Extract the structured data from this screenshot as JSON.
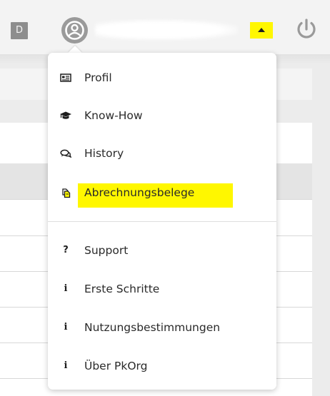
{
  "header": {
    "user_initial": "D",
    "dropdown_caret": "caret-up-icon",
    "power": "power-icon",
    "avatar": "user-circle-icon",
    "highlight_color": "#fff700"
  },
  "menu": {
    "items": [
      {
        "label": "Profil",
        "icon": "id-card-icon"
      },
      {
        "label": "Know-How",
        "icon": "graduation-cap-icon"
      },
      {
        "label": "History",
        "icon": "chat-bubbles-icon"
      },
      {
        "label": "Abrechnungsbelege",
        "icon": "copy-icon",
        "highlighted": true
      }
    ],
    "help_items": [
      {
        "label": "Support",
        "icon": "question-icon"
      },
      {
        "label": "Erste Schritte",
        "icon": "info-icon"
      },
      {
        "label": "Nutzungsbestimmungen",
        "icon": "info-icon"
      },
      {
        "label": "Über PkOrg",
        "icon": "info-icon"
      }
    ]
  }
}
